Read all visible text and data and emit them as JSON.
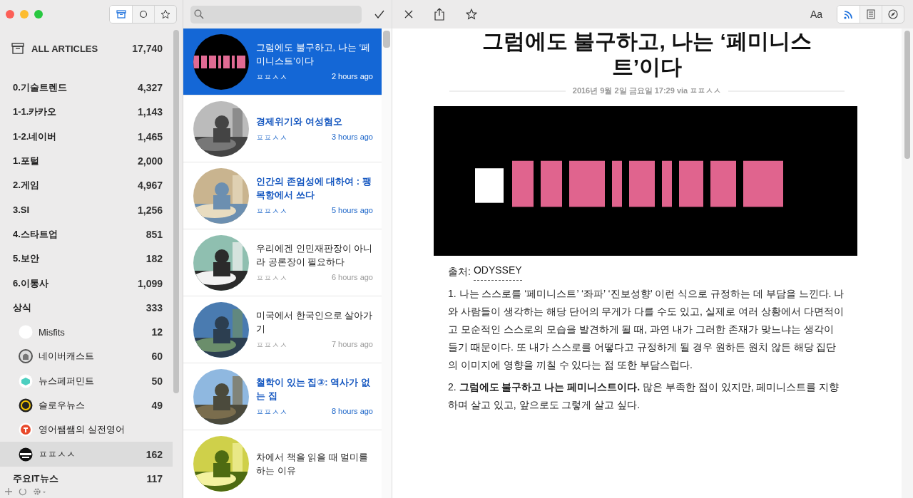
{
  "sidebar": {
    "filters": [
      {
        "kind": "all",
        "selected": true
      },
      {
        "kind": "unread",
        "selected": false
      },
      {
        "kind": "starred",
        "selected": false
      }
    ],
    "all_articles": {
      "label": "ALL ARTICLES",
      "count": "17,740"
    },
    "folders": [
      {
        "name": "0.기술트렌드",
        "count": "4,327",
        "selected": false
      },
      {
        "name": "1-1.카카오",
        "count": "1,143",
        "selected": false
      },
      {
        "name": "1-2.네이버",
        "count": "1,465",
        "selected": false
      },
      {
        "name": "1.포털",
        "count": "2,000",
        "selected": false
      },
      {
        "name": "2.게임",
        "count": "4,967",
        "selected": false
      },
      {
        "name": "3.SI",
        "count": "1,256",
        "selected": false
      },
      {
        "name": "4.스타트업",
        "count": "851",
        "selected": false
      },
      {
        "name": "5.보안",
        "count": "182",
        "selected": false
      },
      {
        "name": "6.이통사",
        "count": "1,099",
        "selected": false
      },
      {
        "name": "상식",
        "count": "333",
        "selected": false,
        "children": [
          {
            "name": "Misfits",
            "count": "12",
            "selected": false
          },
          {
            "name": "네이버캐스트",
            "count": "60",
            "selected": false
          },
          {
            "name": "뉴스페퍼민트",
            "count": "50",
            "selected": false
          },
          {
            "name": "슬로우뉴스",
            "count": "49",
            "selected": false
          },
          {
            "name": "영어쌤쌤의 실전영어",
            "selected": false
          },
          {
            "name": "ㅍㅍㅅㅅ",
            "count": "162",
            "selected": true
          }
        ]
      },
      {
        "name": "주요IT뉴스",
        "count": "117",
        "selected": false
      }
    ]
  },
  "articles": [
    {
      "title": "그럼에도 불구하고, 나는 ‘페미니스트’이다",
      "source": "ㅍㅍㅅㅅ",
      "time": "2 hours ago",
      "unread": false,
      "selected": true
    },
    {
      "title": "경제위기와 여성혐오",
      "source": "ㅍㅍㅅㅅ",
      "time": "3 hours ago",
      "unread": true,
      "selected": false
    },
    {
      "title": "인간의 존엄성에 대하여 : 팽목항에서 쓰다",
      "source": "ㅍㅍㅅㅅ",
      "time": "5 hours ago",
      "unread": true,
      "selected": false
    },
    {
      "title": "우리에겐 인민재판장이 아니라 공론장이 필요하다",
      "source": "ㅍㅍㅅㅅ",
      "time": "6 hours ago",
      "unread": false,
      "selected": false
    },
    {
      "title": "미국에서 한국인으로 살아가기",
      "source": "ㅍㅍㅅㅅ",
      "time": "7 hours ago",
      "unread": false,
      "selected": false
    },
    {
      "title": "철학이 있는 집③: 역사가 없는 집",
      "source": "ㅍㅍㅅㅅ",
      "time": "8 hours ago",
      "unread": true,
      "selected": false
    },
    {
      "title": "차에서 책을 읽을 때 멀미를 하는 이유",
      "unread": false,
      "selected": false
    }
  ],
  "reader": {
    "font_button": "Aa",
    "views": [
      {
        "kind": "rss",
        "selected": true
      },
      {
        "kind": "text",
        "selected": false
      },
      {
        "kind": "web",
        "selected": false
      }
    ],
    "title": "그럼에도 불구하고, 나는 ‘페미니스트’이다",
    "meta": "2016년 9월 2일 금요일 17:29 via ㅍㅍㅅㅅ",
    "image": {
      "kind": "picture"
    },
    "source_label": "출처:",
    "source_link": "ODYSSEY",
    "paragraphs": [
      "1. 나는 스스로를 ‘페미니스트’ ‘좌파’ ‘진보성향’ 이런 식으로 규정하는 데 부담을 느낀다. 나와 사람들이 생각하는 해당 단어의 무게가 다를 수도 있고, 실제로 여러 상황에서 다면적이고 모순적인 스스로의 모습을 발견하게 될 때, 과연 내가 그러한 존재가 맞느냐는 생각이 들기 때문이다. 또 내가 스스로를 어떻다고 규정하게 될 경우 원하든 원치 않든 해당 집단의 이미지에 영향을 끼칠 수 있다는 점 또한 부담스럽다.",
      "2. **그럼에도 불구하고 나는 페미니스트이다.** 많은 부족한 점이 있지만, 페미니스트를 지향하며 살고 있고, 앞으로도 그렇게 살고 싶다."
    ]
  }
}
